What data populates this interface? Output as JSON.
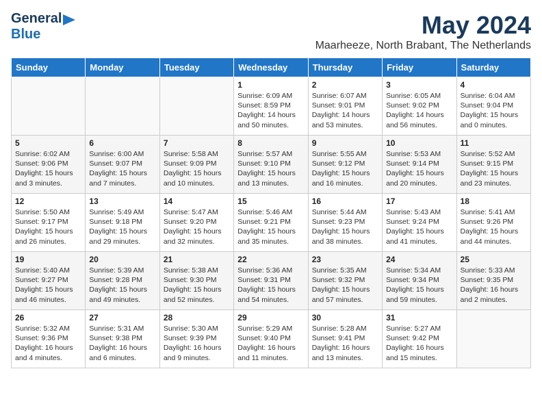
{
  "logo": {
    "line1": "General",
    "line2": "Blue"
  },
  "title": "May 2024",
  "location": "Maarheeze, North Brabant, The Netherlands",
  "days_of_week": [
    "Sunday",
    "Monday",
    "Tuesday",
    "Wednesday",
    "Thursday",
    "Friday",
    "Saturday"
  ],
  "weeks": [
    [
      {
        "day": "",
        "info": ""
      },
      {
        "day": "",
        "info": ""
      },
      {
        "day": "",
        "info": ""
      },
      {
        "day": "1",
        "info": "Sunrise: 6:09 AM\nSunset: 8:59 PM\nDaylight: 14 hours\nand 50 minutes."
      },
      {
        "day": "2",
        "info": "Sunrise: 6:07 AM\nSunset: 9:01 PM\nDaylight: 14 hours\nand 53 minutes."
      },
      {
        "day": "3",
        "info": "Sunrise: 6:05 AM\nSunset: 9:02 PM\nDaylight: 14 hours\nand 56 minutes."
      },
      {
        "day": "4",
        "info": "Sunrise: 6:04 AM\nSunset: 9:04 PM\nDaylight: 15 hours\nand 0 minutes."
      }
    ],
    [
      {
        "day": "5",
        "info": "Sunrise: 6:02 AM\nSunset: 9:06 PM\nDaylight: 15 hours\nand 3 minutes."
      },
      {
        "day": "6",
        "info": "Sunrise: 6:00 AM\nSunset: 9:07 PM\nDaylight: 15 hours\nand 7 minutes."
      },
      {
        "day": "7",
        "info": "Sunrise: 5:58 AM\nSunset: 9:09 PM\nDaylight: 15 hours\nand 10 minutes."
      },
      {
        "day": "8",
        "info": "Sunrise: 5:57 AM\nSunset: 9:10 PM\nDaylight: 15 hours\nand 13 minutes."
      },
      {
        "day": "9",
        "info": "Sunrise: 5:55 AM\nSunset: 9:12 PM\nDaylight: 15 hours\nand 16 minutes."
      },
      {
        "day": "10",
        "info": "Sunrise: 5:53 AM\nSunset: 9:14 PM\nDaylight: 15 hours\nand 20 minutes."
      },
      {
        "day": "11",
        "info": "Sunrise: 5:52 AM\nSunset: 9:15 PM\nDaylight: 15 hours\nand 23 minutes."
      }
    ],
    [
      {
        "day": "12",
        "info": "Sunrise: 5:50 AM\nSunset: 9:17 PM\nDaylight: 15 hours\nand 26 minutes."
      },
      {
        "day": "13",
        "info": "Sunrise: 5:49 AM\nSunset: 9:18 PM\nDaylight: 15 hours\nand 29 minutes."
      },
      {
        "day": "14",
        "info": "Sunrise: 5:47 AM\nSunset: 9:20 PM\nDaylight: 15 hours\nand 32 minutes."
      },
      {
        "day": "15",
        "info": "Sunrise: 5:46 AM\nSunset: 9:21 PM\nDaylight: 15 hours\nand 35 minutes."
      },
      {
        "day": "16",
        "info": "Sunrise: 5:44 AM\nSunset: 9:23 PM\nDaylight: 15 hours\nand 38 minutes."
      },
      {
        "day": "17",
        "info": "Sunrise: 5:43 AM\nSunset: 9:24 PM\nDaylight: 15 hours\nand 41 minutes."
      },
      {
        "day": "18",
        "info": "Sunrise: 5:41 AM\nSunset: 9:26 PM\nDaylight: 15 hours\nand 44 minutes."
      }
    ],
    [
      {
        "day": "19",
        "info": "Sunrise: 5:40 AM\nSunset: 9:27 PM\nDaylight: 15 hours\nand 46 minutes."
      },
      {
        "day": "20",
        "info": "Sunrise: 5:39 AM\nSunset: 9:28 PM\nDaylight: 15 hours\nand 49 minutes."
      },
      {
        "day": "21",
        "info": "Sunrise: 5:38 AM\nSunset: 9:30 PM\nDaylight: 15 hours\nand 52 minutes."
      },
      {
        "day": "22",
        "info": "Sunrise: 5:36 AM\nSunset: 9:31 PM\nDaylight: 15 hours\nand 54 minutes."
      },
      {
        "day": "23",
        "info": "Sunrise: 5:35 AM\nSunset: 9:32 PM\nDaylight: 15 hours\nand 57 minutes."
      },
      {
        "day": "24",
        "info": "Sunrise: 5:34 AM\nSunset: 9:34 PM\nDaylight: 15 hours\nand 59 minutes."
      },
      {
        "day": "25",
        "info": "Sunrise: 5:33 AM\nSunset: 9:35 PM\nDaylight: 16 hours\nand 2 minutes."
      }
    ],
    [
      {
        "day": "26",
        "info": "Sunrise: 5:32 AM\nSunset: 9:36 PM\nDaylight: 16 hours\nand 4 minutes."
      },
      {
        "day": "27",
        "info": "Sunrise: 5:31 AM\nSunset: 9:38 PM\nDaylight: 16 hours\nand 6 minutes."
      },
      {
        "day": "28",
        "info": "Sunrise: 5:30 AM\nSunset: 9:39 PM\nDaylight: 16 hours\nand 9 minutes."
      },
      {
        "day": "29",
        "info": "Sunrise: 5:29 AM\nSunset: 9:40 PM\nDaylight: 16 hours\nand 11 minutes."
      },
      {
        "day": "30",
        "info": "Sunrise: 5:28 AM\nSunset: 9:41 PM\nDaylight: 16 hours\nand 13 minutes."
      },
      {
        "day": "31",
        "info": "Sunrise: 5:27 AM\nSunset: 9:42 PM\nDaylight: 16 hours\nand 15 minutes."
      },
      {
        "day": "",
        "info": ""
      }
    ]
  ]
}
